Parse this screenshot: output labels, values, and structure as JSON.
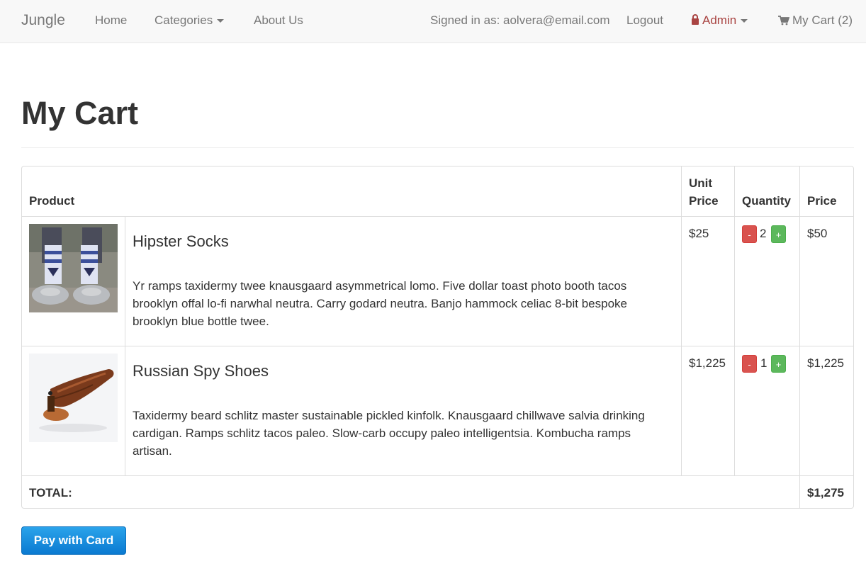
{
  "navbar": {
    "brand": "Jungle",
    "home": "Home",
    "categories": "Categories",
    "about": "About Us",
    "signed_in": "Signed in as: aolvera@email.com",
    "logout": "Logout",
    "admin": "Admin",
    "cart": "My Cart (2)"
  },
  "page": {
    "title": "My Cart"
  },
  "table": {
    "headers": {
      "product": "Product",
      "unit_price_1": "Unit",
      "unit_price_2": "Price",
      "quantity": "Quantity",
      "price": "Price"
    },
    "rows": [
      {
        "name": "Hipster Socks",
        "description": "Yr ramps taxidermy twee knausgaard asymmetrical lomo. Five dollar toast photo booth tacos brooklyn offal lo-fi narwhal neutra. Carry godard neutra. Banjo hammock celiac 8-bit bespoke brooklyn blue bottle twee.",
        "unit_price": "$25",
        "quantity": "2",
        "price": "$50",
        "image": "socks-image"
      },
      {
        "name": "Russian Spy Shoes",
        "description": "Taxidermy beard schlitz master sustainable pickled kinfolk. Knausgaard chillwave salvia drinking cardigan. Ramps schlitz tacos paleo. Slow-carb occupy paleo intelligentsia. Kombucha ramps artisan.",
        "unit_price": "$1,225",
        "quantity": "1",
        "price": "$1,225",
        "image": "shoe-image"
      }
    ],
    "total_label": "TOTAL:",
    "total_value": "$1,275",
    "minus": "-",
    "plus": "+"
  },
  "pay_button": "Pay with Card",
  "colors": {
    "admin": "#a94442",
    "pay": "#0b7ad1",
    "minus": "#d9534f",
    "plus": "#5cb85c"
  },
  "icons": {
    "lock": "lock-icon",
    "cart": "cart-icon",
    "caret": "caret-down-icon"
  }
}
